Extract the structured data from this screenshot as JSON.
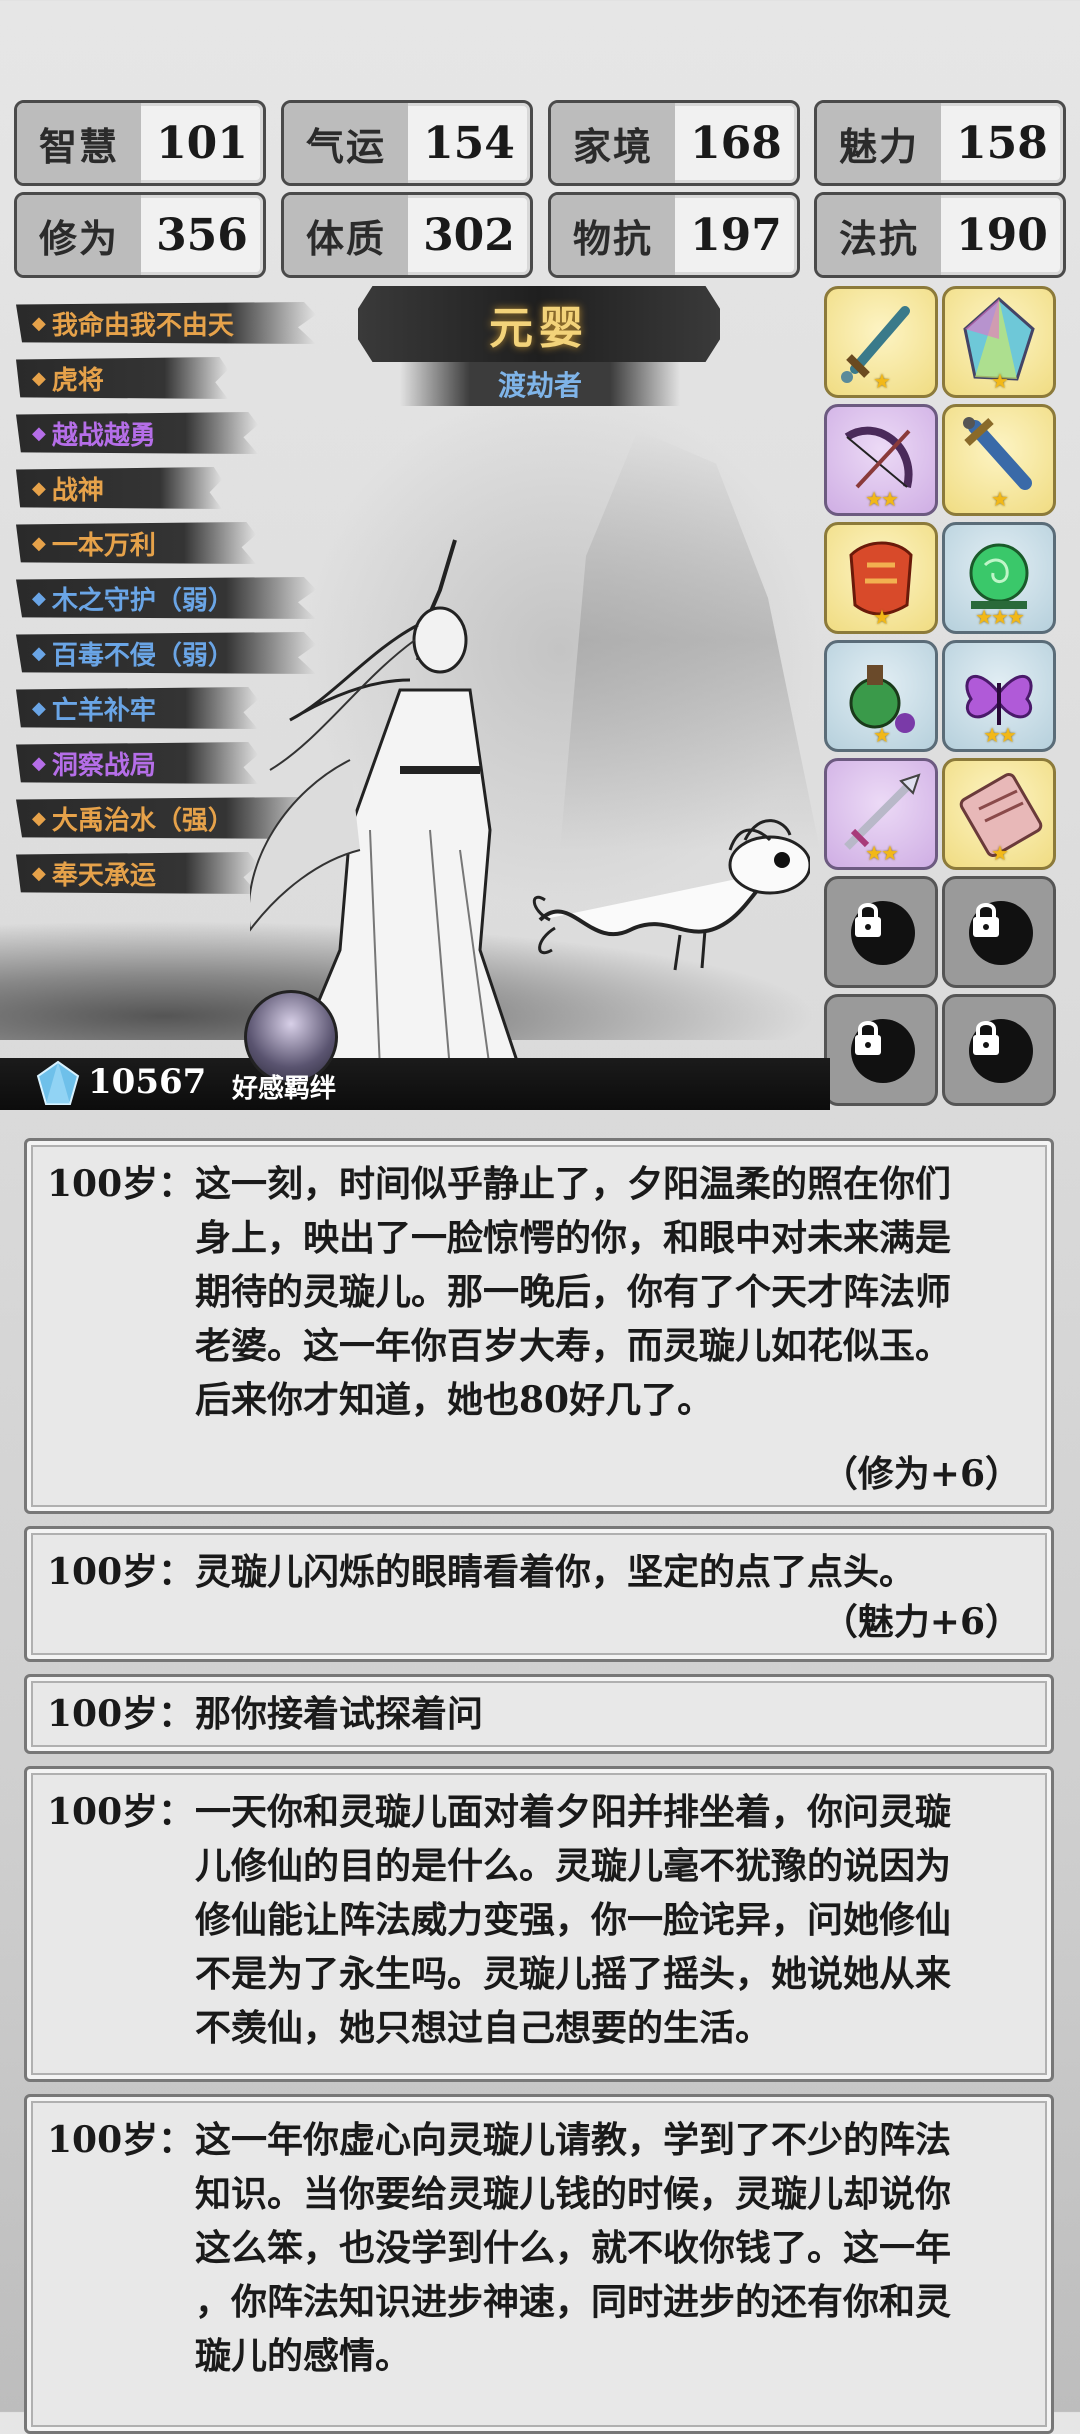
{
  "stats": [
    {
      "label": "智慧",
      "value": "101"
    },
    {
      "label": "气运",
      "value": "154"
    },
    {
      "label": "家境",
      "value": "168"
    },
    {
      "label": "魅力",
      "value": "158"
    },
    {
      "label": "修为",
      "value": "356"
    },
    {
      "label": "体质",
      "value": "302"
    },
    {
      "label": "物抗",
      "value": "197"
    },
    {
      "label": "法抗",
      "value": "190"
    }
  ],
  "traits": [
    {
      "name": "我命由我不由天",
      "color": "#e6a24a"
    },
    {
      "name": "虎将",
      "color": "#e6a24a"
    },
    {
      "name": "越战越勇",
      "color": "#b56ee8"
    },
    {
      "name": "战神",
      "color": "#e6a24a"
    },
    {
      "name": "一本万利",
      "color": "#e6a24a"
    },
    {
      "name": "木之守护（弱）",
      "color": "#6aa5e6"
    },
    {
      "name": "百毒不侵（弱）",
      "color": "#6aa5e6"
    },
    {
      "name": "亡羊补牢",
      "color": "#6aa5e6"
    },
    {
      "name": "洞察战局",
      "color": "#b56ee8"
    },
    {
      "name": "大禹治水（强）",
      "color": "#e6a24a"
    },
    {
      "name": "奉天承运",
      "color": "#e6a24a"
    }
  ],
  "realm": {
    "title": "元婴",
    "subtitle": "渡劫者"
  },
  "items": [
    {
      "icon": "sword-icon",
      "stars": "★"
    },
    {
      "icon": "crystal-icon",
      "stars": "★"
    },
    {
      "icon": "bow-icon",
      "stars": "★★"
    },
    {
      "icon": "dagger-icon",
      "stars": "★"
    },
    {
      "icon": "armor-icon",
      "stars": "★"
    },
    {
      "icon": "orb-icon",
      "stars": "★★★"
    },
    {
      "icon": "potion-icon",
      "stars": "★"
    },
    {
      "icon": "butterfly-icon",
      "stars": "★★"
    },
    {
      "icon": "spear-icon",
      "stars": "★★"
    },
    {
      "icon": "scroll-icon",
      "stars": "★"
    },
    {
      "icon": "lock-icon"
    },
    {
      "icon": "lock-icon"
    },
    {
      "icon": "lock-icon"
    },
    {
      "icon": "lock-icon"
    }
  ],
  "currency": {
    "value": "10567",
    "icon": "diamond-icon"
  },
  "bond_label": "好感羁绊",
  "log": [
    {
      "age": "100岁：",
      "lines": [
        "这一刻，时间似乎静止了，夕阳温柔的照在你们",
        "身上，映出了一脸惊愕的你，和眼中对未来满是",
        "期待的灵璇儿。那一晚后，你有了个天才阵法师",
        "老婆。这一年你百岁大寿，而灵璇儿如花似玉。",
        "后来你才知道，她也80好几了。"
      ],
      "gain": "（修为+6）"
    },
    {
      "age": "100岁：",
      "lines": [
        "灵璇儿闪烁的眼睛看着你，坚定的点了点头。"
      ],
      "gain": "（魅力+6）"
    },
    {
      "age": "100岁：",
      "lines": [
        "那你接着试探着问"
      ],
      "gain": ""
    },
    {
      "age": "100岁：",
      "lines": [
        "一天你和灵璇儿面对着夕阳并排坐着，你问灵璇",
        "儿修仙的目的是什么。灵璇儿毫不犹豫的说因为",
        "修仙能让阵法威力变强，你一脸诧异，问她修仙",
        "不是为了永生吗。灵璇儿摇了摇头，她说她从来",
        "不羡仙，她只想过自己想要的生活。"
      ],
      "gain": ""
    },
    {
      "age": "100岁：",
      "lines": [
        "这一年你虚心向灵璇儿请教，学到了不少的阵法",
        "知识。当你要给灵璇儿钱的时候，灵璇儿却说你",
        "这么笨，也没学到什么，就不收你钱了。这一年",
        "，你阵法知识进步神速，同时进步的还有你和灵",
        "璇儿的感情。"
      ],
      "gain": ""
    }
  ]
}
